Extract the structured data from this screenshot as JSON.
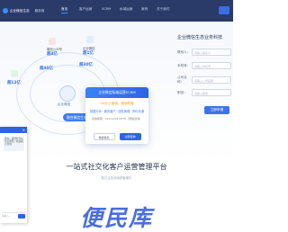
{
  "nav": {
    "brand": "企业微信生态",
    "brand_sub": "服务商",
    "tabs": [
      "首页",
      "客户运营",
      "SCRM",
      "私域运营",
      "案例",
      "关于我们"
    ]
  },
  "diagram": {
    "hub_label": "企业微信",
    "metrics": [
      {
        "label": "微信公众号",
        "value": "超4亿",
        "unit": "用户"
      },
      {
        "label": "群聊",
        "value": "超40亿",
        "unit": "条消息"
      },
      {
        "label": "企业微信",
        "value": "超1亿",
        "unit": "日活"
      },
      {
        "label": "企业认证",
        "value": "超30亿",
        "unit": "位员工"
      },
      {
        "label": "微信",
        "value": "超12亿",
        "unit": "用户"
      }
    ],
    "cover_label": "融合微信生态"
  },
  "popup": {
    "title": "企业微信私域运营SCRM",
    "line1": "OA办公营销，营销获客",
    "line2": "数据分析 · 服务客户 · 团队管理 · 即时沟通",
    "tel": "咨询客服：010-1234-5678（网络咨询）",
    "cancel": "稍后联系",
    "confirm": "立即咨询"
  },
  "form": {
    "title": "企业微信生态业务科技",
    "rows": [
      {
        "label": "联系人：",
        "placeholder": "请输入联系人"
      },
      {
        "label": "手机号：",
        "placeholder": "请输入手机号"
      },
      {
        "label": "公司名称：",
        "placeholder": "请输入公司名称"
      },
      {
        "label": "职务：",
        "placeholder": "请输入职务"
      }
    ],
    "submit": "立即申请"
  },
  "slogan": "一站式社交化客户运营管理平台",
  "slogan_sub": "助力企业持续获客增长",
  "chat": {
    "bubble": "您好，请问有什么可以帮您？欢迎留言咨询",
    "input_placeholder": "请输入..."
  },
  "watermark": "便民库"
}
